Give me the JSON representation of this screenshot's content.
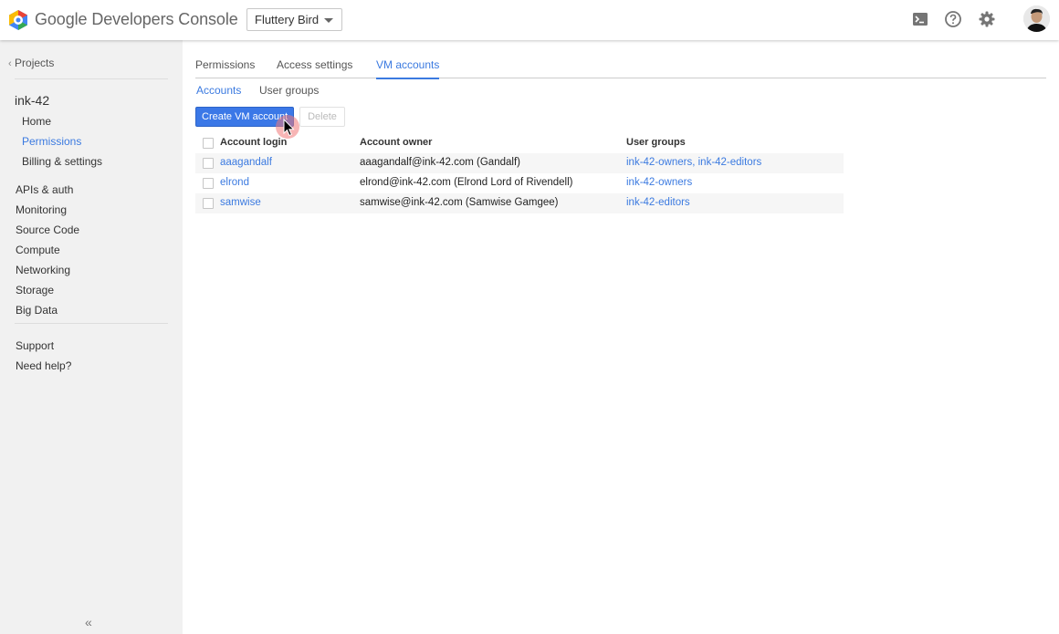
{
  "header": {
    "brand": "Google Developers Console",
    "project_selector": "Fluttery Bird",
    "icons": [
      "terminal-icon",
      "help-icon",
      "gear-icon"
    ]
  },
  "sidebar": {
    "back_label": "Projects",
    "project_name": "ink-42",
    "project_items": [
      {
        "label": "Home"
      },
      {
        "label": "Permissions",
        "active": true
      },
      {
        "label": "Billing & settings"
      }
    ],
    "sections": [
      {
        "label": "APIs & auth"
      },
      {
        "label": "Monitoring"
      },
      {
        "label": "Source Code"
      },
      {
        "label": "Compute"
      },
      {
        "label": "Networking"
      },
      {
        "label": "Storage"
      },
      {
        "label": "Big Data"
      }
    ],
    "footer_items": [
      {
        "label": "Support"
      },
      {
        "label": "Need help?"
      }
    ],
    "collapse_label": "«"
  },
  "tabs": [
    {
      "label": "Permissions"
    },
    {
      "label": "Access settings"
    },
    {
      "label": "VM accounts",
      "active": true
    }
  ],
  "subtabs": [
    {
      "label": "Accounts",
      "active": true
    },
    {
      "label": "User groups"
    }
  ],
  "toolbar": {
    "create_label": "Create VM account",
    "delete_label": "Delete"
  },
  "table": {
    "columns": [
      "Account login",
      "Account owner",
      "User groups"
    ],
    "rows": [
      {
        "login": "aaagandalf",
        "owner": "aaagandalf@ink-42.com (Gandalf)",
        "groups": "ink-42-owners, ink-42-editors"
      },
      {
        "login": "elrond",
        "owner": "elrond@ink-42.com (Elrond Lord of Rivendell)",
        "groups": "ink-42-owners"
      },
      {
        "login": "samwise",
        "owner": "samwise@ink-42.com (Samwise Gamgee)",
        "groups": "ink-42-editors"
      }
    ]
  },
  "colors": {
    "accent": "#3b7ae0",
    "primary_button": "#3b78e7",
    "sidebar_bg": "#f1f1f1"
  }
}
